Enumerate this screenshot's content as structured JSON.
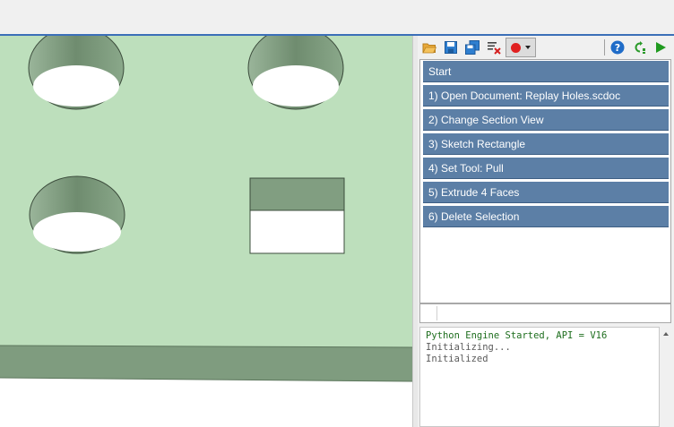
{
  "toolbar": {
    "icons": [
      "open-folder-icon",
      "save-icon",
      "save-as-icon",
      "clear-icon",
      "record-icon",
      "dropdown-arrow-icon",
      "help-icon",
      "step-icon",
      "run-icon"
    ]
  },
  "steps": [
    {
      "label": "Start"
    },
    {
      "label": "1) Open Document: Replay Holes.scdoc"
    },
    {
      "label": "2) Change Section View"
    },
    {
      "label": "3) Sketch Rectangle"
    },
    {
      "label": "4) Set Tool: Pull"
    },
    {
      "label": "5) Extrude 4 Faces"
    },
    {
      "label": "6) Delete Selection"
    }
  ],
  "command": {
    "value": ""
  },
  "console": {
    "lines": [
      "Python Engine Started, API = V16",
      "Initializing...",
      "Initialized"
    ]
  },
  "colors": {
    "step_bg": "#5c7fa6",
    "model_face": "#bddfbc",
    "model_side": "#7f9c7f",
    "accent_line": "#3b6fb8"
  }
}
